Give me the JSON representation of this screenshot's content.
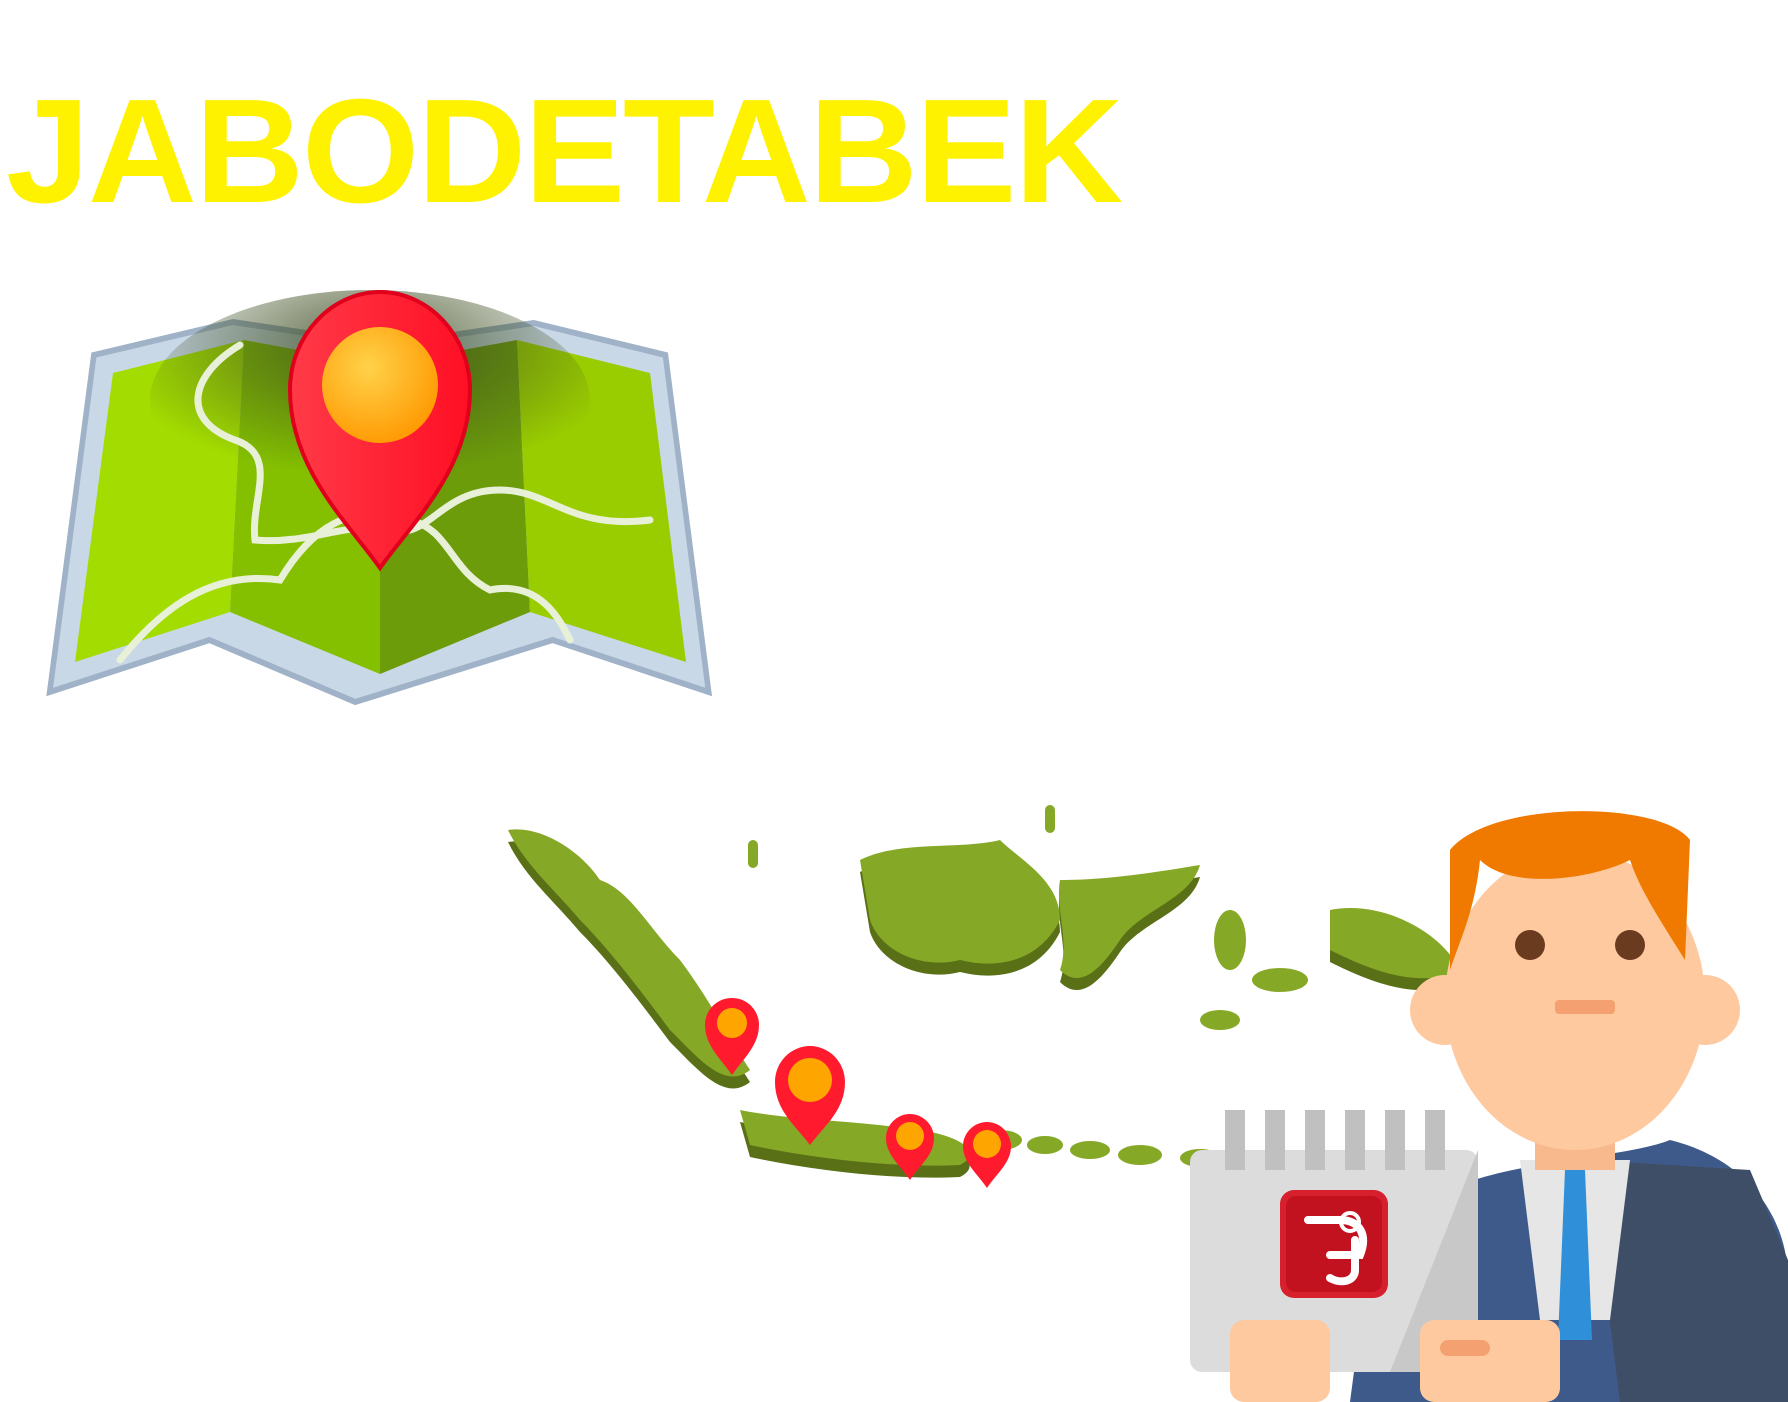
{
  "headline": {
    "text": "JABODETABEK"
  },
  "icons": {
    "map": "folded-map-with-location-pin",
    "indonesia": "indonesia-map-with-location-pins",
    "person": "businessman-holding-notepad"
  },
  "colors": {
    "headline": "#fff200",
    "map_green": "#8fcc00",
    "pin_red": "#ff2b37",
    "pin_core": "#ffa500",
    "island_green": "#86a827",
    "island_shadow": "#5a7016",
    "suit": "#3e5a8a",
    "hair": "#f07a00",
    "skin": "#ffc9a0"
  }
}
